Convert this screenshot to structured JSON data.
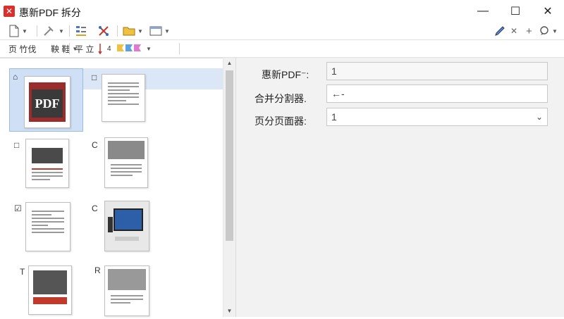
{
  "window": {
    "title": "惠新PDF 拆分",
    "app_icon": "✕",
    "controls": {
      "minimize": "—",
      "maximize": "☐",
      "close": "✕"
    }
  },
  "toolbar1": {
    "right_items": [
      "✕",
      "+"
    ]
  },
  "toolbar2": {
    "items": [
      "页 竹伐",
      "鞅 鞋",
      "平 立",
      "4"
    ]
  },
  "sidebar": {
    "markers": [
      "⌂",
      "□",
      "□",
      "C",
      "☑",
      "C",
      "T",
      "R"
    ],
    "cover_text": "PDF"
  },
  "form": {
    "fields": [
      {
        "label": "惠新PDF⁻:",
        "value": "1"
      },
      {
        "label": "合并分割器.",
        "value": "←-"
      },
      {
        "label": "页分页面器:",
        "value": "1"
      }
    ]
  },
  "colors": {
    "accent": "#d9302c",
    "selection": "#cfe0f6"
  }
}
